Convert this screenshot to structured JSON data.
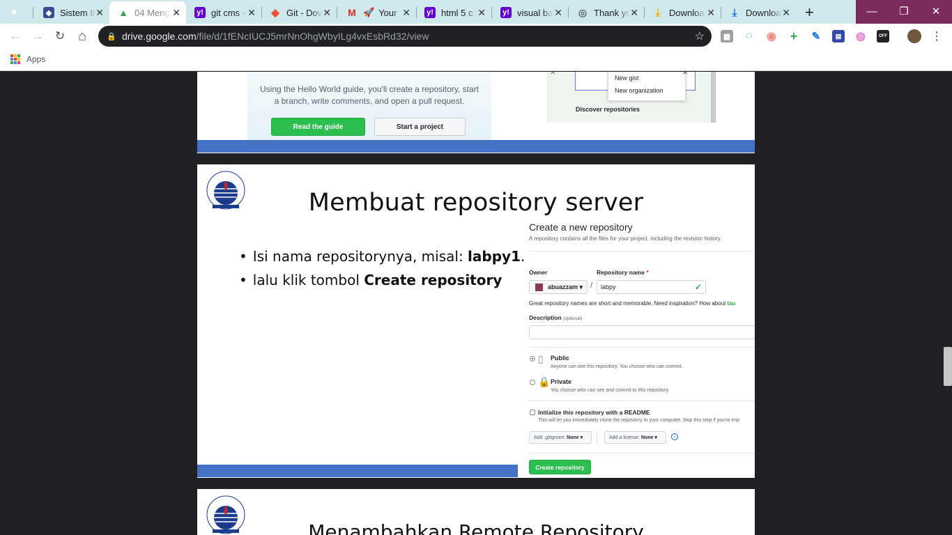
{
  "tabs": [
    {
      "title": "",
      "icon": "github-icon",
      "color": "#cfe8ec",
      "glyph": ""
    },
    {
      "title": "Sistem In",
      "icon": "university-icon",
      "color": "#3b4a8a",
      "glyph": "◆"
    },
    {
      "title": "04 Meng",
      "icon": "google-drive-icon",
      "color": "#34a853",
      "glyph": "▲",
      "active": true
    },
    {
      "title": "git cms -",
      "icon": "yahoo-icon",
      "color": "#6001d2",
      "glyph": "y!"
    },
    {
      "title": "Git - Dov",
      "icon": "git-icon",
      "color": "#f05033",
      "glyph": "◆"
    },
    {
      "title": "Your",
      "icon": "gmail-icon",
      "color": "#ffffff",
      "glyph": "M"
    },
    {
      "title": "html 5 c",
      "icon": "yahoo-icon",
      "color": "#6001d2",
      "glyph": "y!"
    },
    {
      "title": "visual ba",
      "icon": "yahoo-icon",
      "color": "#6001d2",
      "glyph": "y!"
    },
    {
      "title": "Thank yo",
      "icon": "globe-icon",
      "color": "#5f6368",
      "glyph": "◎"
    },
    {
      "title": "Downloa",
      "icon": "download-icon",
      "color": "#f4b400",
      "glyph": "⤓"
    },
    {
      "title": "Downloa",
      "icon": "download-icon",
      "color": "#1a73e8",
      "glyph": "⤓"
    }
  ],
  "new_tab": "+",
  "window": {
    "minimize": "—",
    "restore": "❐",
    "close": "✕"
  },
  "nav": {
    "back": "←",
    "forward": "→",
    "reload": "↻",
    "home": "⌂"
  },
  "omnibox": {
    "host": "drive.google.com",
    "path": "/file/d/1fENcIUCJ5mrNnOhgWbyILg4vxEsbRd32/view",
    "star": "☆"
  },
  "extensions": [
    {
      "name": "extension-1-icon",
      "color": "#9e9e9e",
      "glyph": "▦"
    },
    {
      "name": "extension-2-icon",
      "color": "#1ba3e0",
      "glyph": "◌"
    },
    {
      "name": "extension-3-icon",
      "color": "#f28b82",
      "glyph": "◉"
    },
    {
      "name": "extension-4-icon",
      "color": "#34a853",
      "glyph": "+"
    },
    {
      "name": "extension-5-icon",
      "color": "#1a73e8",
      "glyph": "✎"
    },
    {
      "name": "extension-6-icon",
      "color": "#3949ab",
      "glyph": "▤"
    },
    {
      "name": "extension-7-icon",
      "color": "#e57fd0",
      "glyph": "◍"
    },
    {
      "name": "extension-8-icon",
      "color": "#222222",
      "glyph": "OFF"
    }
  ],
  "bookmarks": {
    "apps_label": "Apps"
  },
  "slide1": {
    "guide_text_1": "Using the Hello World guide, you'll create a repository, start",
    "guide_text_2": "a branch, write comments, and open a pull request.",
    "read_guide": "Read the guide",
    "start_project": "Start a project",
    "menu_item_1": "New gist",
    "menu_item_2": "New organization",
    "discover": "Discover repositories"
  },
  "slide2": {
    "title": "Membuat repository server",
    "bullet_1_prefix": "Isi nama repositorynya, misal: ",
    "bullet_1_bold": "labpy1",
    "bullet_1_suffix": ".",
    "bullet_2_prefix": "lalu klik tombol ",
    "bullet_2_bold": "Create repository",
    "form": {
      "heading": "Create a new repository",
      "subheading": "A repository contains all the files for your project, including the revision history.",
      "owner_label": "Owner",
      "repo_label": "Repository name",
      "required_mark": "*",
      "owner_value": "abuazzam ▾",
      "slash": "/",
      "repo_value": "labpy",
      "valid_mark": "✓",
      "hint_prefix": "Great repository names are short and memorable. Need inspiration? How about ",
      "hint_suggestion": "lau",
      "description_label": "Description",
      "description_optional": "(optional)",
      "public_title": "Public",
      "public_desc": "Anyone can see this repository. You choose who can commit.",
      "private_title": "Private",
      "private_desc": "You choose who can see and commit to this repository.",
      "readme_title": "Initialize this repository with a README",
      "readme_desc": "This will let you immediately clone the repository to your computer. Skip this step if you're imp",
      "gitignore_label": "Add .gitignore:",
      "gitignore_value": "None ▾",
      "license_label": "Add a license:",
      "license_value": "None ▾",
      "info": "i",
      "create_button": "Create repository"
    }
  },
  "slide3": {
    "title": "Menambahkan Remote Repository"
  }
}
